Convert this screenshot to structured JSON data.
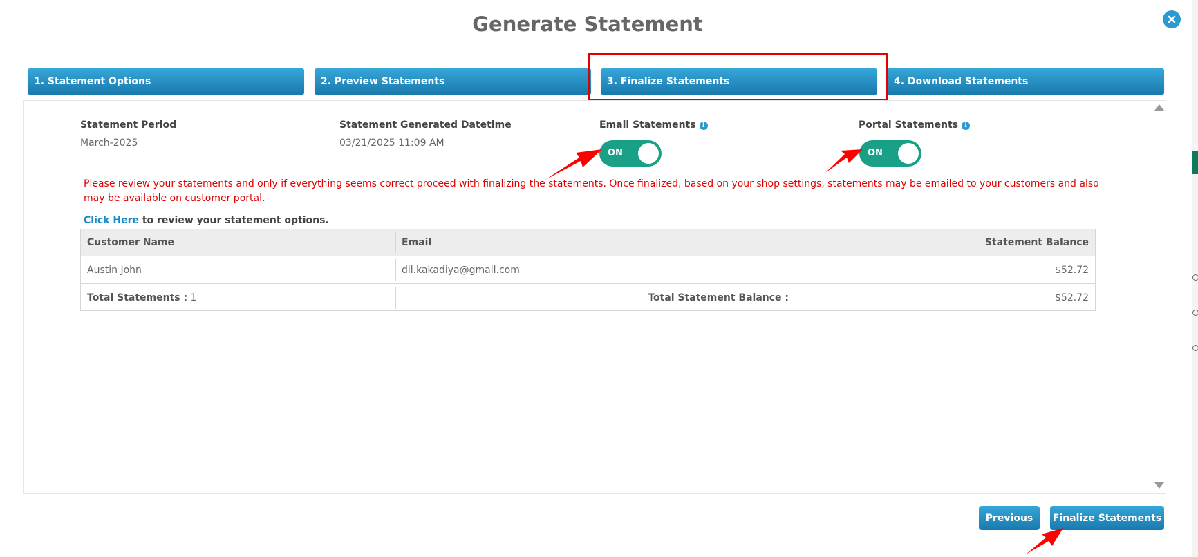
{
  "dialog": {
    "title": "Generate Statement"
  },
  "steps": [
    {
      "label": "1. Statement Options"
    },
    {
      "label": "2. Preview Statements"
    },
    {
      "label": "3. Finalize Statements"
    },
    {
      "label": "4. Download Statements"
    }
  ],
  "summary": {
    "period_label": "Statement Period",
    "period_value": "March-2025",
    "generated_label": "Statement Generated Datetime",
    "generated_value": "03/21/2025 11:09 AM",
    "email_label": "Email Statements",
    "email_toggle": "ON",
    "portal_label": "Portal Statements",
    "portal_toggle": "ON"
  },
  "warning_text": "Please review your statements and only if everything seems correct proceed with finalizing the statements. Once finalized, based on your shop settings, statements may be emailed to your customers and also may be available on customer portal.",
  "review": {
    "link": "Click Here",
    "rest": " to review your statement options."
  },
  "table": {
    "headers": [
      "Customer Name",
      "Email",
      "Statement Balance"
    ],
    "rows": [
      [
        "Austin John",
        "dil.kakadiya@gmail.com",
        "$52.72"
      ]
    ],
    "total_label": "Total Statements :",
    "total_count": "1",
    "total_balance_label": "Total Statement Balance :",
    "total_balance": "$52.72"
  },
  "buttons": {
    "previous": "Previous",
    "finalize": "Finalize Statements"
  },
  "colors": {
    "accent": "#2a9ad0",
    "toggle_on": "#1aa086",
    "warning": "#e00000",
    "highlight": "#e50000"
  },
  "icons": [
    "close-icon",
    "info-icon",
    "scroll-up-icon",
    "scroll-down-icon",
    "pointer-arrow-icon"
  ]
}
